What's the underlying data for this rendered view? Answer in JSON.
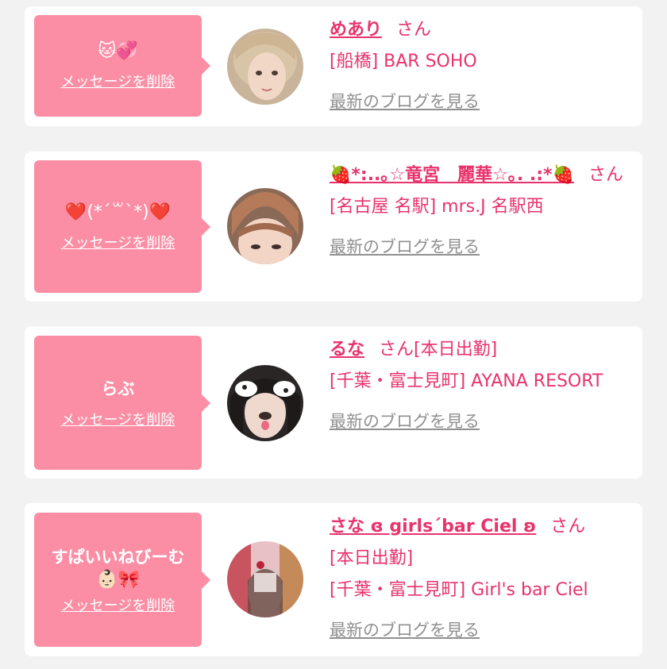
{
  "delete_label": "メッセージを削除",
  "blog_label": "最新のブログを見る",
  "honorific": "さん",
  "entries": [
    {
      "message": "",
      "emoji": "🐱💞",
      "name": "めあり",
      "status": "",
      "shop": "[船橋] BAR SOHO"
    },
    {
      "message": "",
      "emoji": "❤️(*´꒳`*)❤️",
      "name": "🍓*:..｡☆竜宮　麗華☆｡. .:*🍓",
      "status": "",
      "shop": "[名古屋 名駅] mrs.J 名駅西"
    },
    {
      "message": "らぶ",
      "emoji": "",
      "name": "るな",
      "status": "[本日出勤]",
      "shop": "[千葉・富士見町] AYANA RESORT"
    },
    {
      "message": "すぱいいねびーむ",
      "emoji": "👶🏻🎀",
      "name": "さな ɞ girls´bar Ciel ʚ",
      "status": "[本日出勤]",
      "shop": "[千葉・富士見町] Girl's bar Ciel"
    }
  ],
  "colors": {
    "background": "#f2f2f2",
    "bubble": "#fb8ea4",
    "accent": "#e8336c",
    "link_gray": "#909090"
  }
}
